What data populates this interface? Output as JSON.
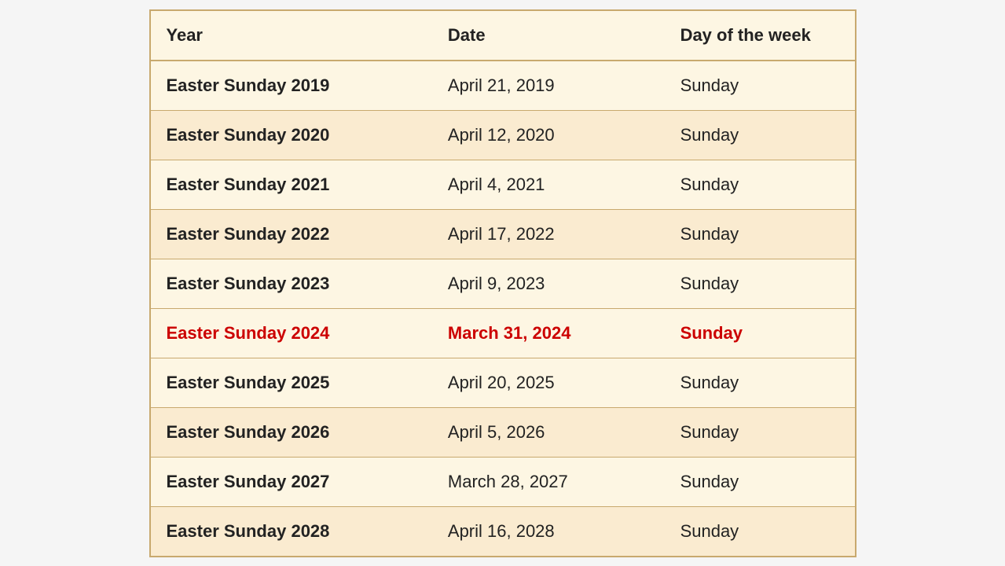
{
  "table": {
    "headers": {
      "year": "Year",
      "date": "Date",
      "day": "Day of the week"
    },
    "rows": [
      {
        "year": "Easter Sunday 2019",
        "date": "April 21, 2019",
        "day": "Sunday",
        "highlight": false
      },
      {
        "year": "Easter Sunday 2020",
        "date": "April 12, 2020",
        "day": "Sunday",
        "highlight": false
      },
      {
        "year": "Easter Sunday 2021",
        "date": "April 4, 2021",
        "day": "Sunday",
        "highlight": false
      },
      {
        "year": "Easter Sunday 2022",
        "date": "April 17, 2022",
        "day": "Sunday",
        "highlight": false
      },
      {
        "year": "Easter Sunday 2023",
        "date": "April 9, 2023",
        "day": "Sunday",
        "highlight": false
      },
      {
        "year": "Easter Sunday 2024",
        "date": "March 31, 2024",
        "day": "Sunday",
        "highlight": true
      },
      {
        "year": "Easter Sunday 2025",
        "date": "April 20, 2025",
        "day": "Sunday",
        "highlight": false
      },
      {
        "year": "Easter Sunday 2026",
        "date": "April 5, 2026",
        "day": "Sunday",
        "highlight": false
      },
      {
        "year": "Easter Sunday 2027",
        "date": "March 28, 2027",
        "day": "Sunday",
        "highlight": false
      },
      {
        "year": "Easter Sunday 2028",
        "date": "April 16, 2028",
        "day": "Sunday",
        "highlight": false
      }
    ]
  }
}
